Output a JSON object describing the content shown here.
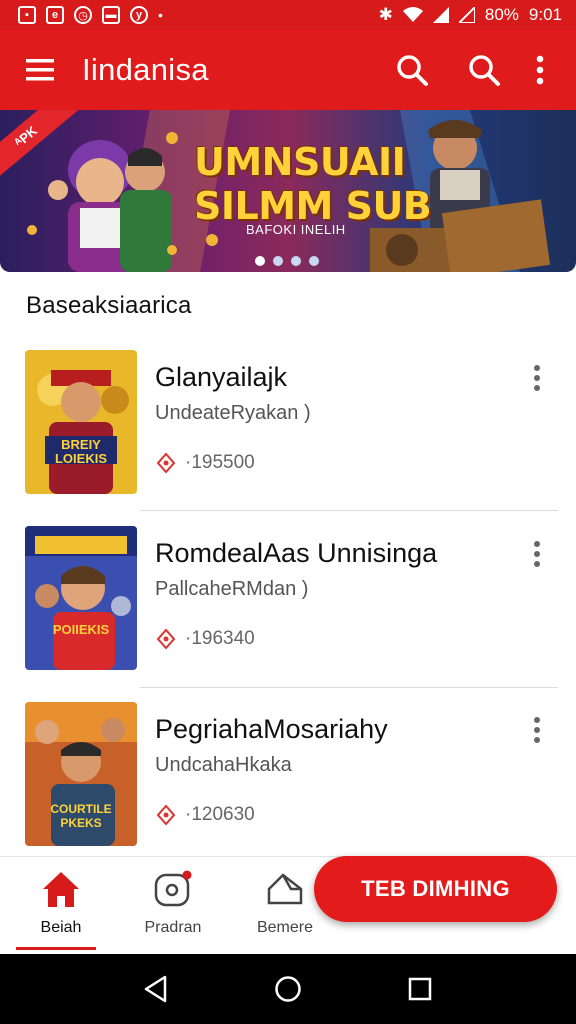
{
  "status_bar": {
    "battery": "80%",
    "time": "9:01"
  },
  "app_bar": {
    "title": "Iindanisa",
    "icons": [
      "menu-icon",
      "search-icon",
      "search-icon",
      "more-vertical-icon"
    ]
  },
  "banner": {
    "ribbon": "ᴬPK",
    "title_line1": "UMNSUAII",
    "title_line2": "SILMM SUB",
    "subtitle": "BAFOKI INELIH",
    "slide_count": 4,
    "active_slide": 1
  },
  "section": {
    "title": "Baseaksiaarica"
  },
  "items": [
    {
      "name": "Glanyailajk",
      "subtitle": "UndeateRyakan )",
      "meta": "·195500",
      "thumb_text": "BREIY\nLOIEKIS"
    },
    {
      "name": "RomdealAas Unnisinga",
      "subtitle": "PallcaheRMdan )",
      "meta": "·196340",
      "thumb_text": "POIIEKIS"
    },
    {
      "name": "PegriahaMosariahy",
      "subtitle": "UndcahaHkaka",
      "meta": "·120630",
      "thumb_text": "COURTILE\nPKEKS"
    }
  ],
  "bottom_nav": {
    "items": [
      {
        "label": "Beiah",
        "icon": "home-icon",
        "active": true
      },
      {
        "label": "Pradran",
        "icon": "notification-icon",
        "active": false
      },
      {
        "label": "Bemere",
        "icon": "house-outline-icon",
        "active": false
      }
    ],
    "fab_label": "TEB DIMHING"
  },
  "colors": {
    "primary": "#df1b1b",
    "status_bar": "#d71a1a",
    "fab": "#e31b1b"
  }
}
